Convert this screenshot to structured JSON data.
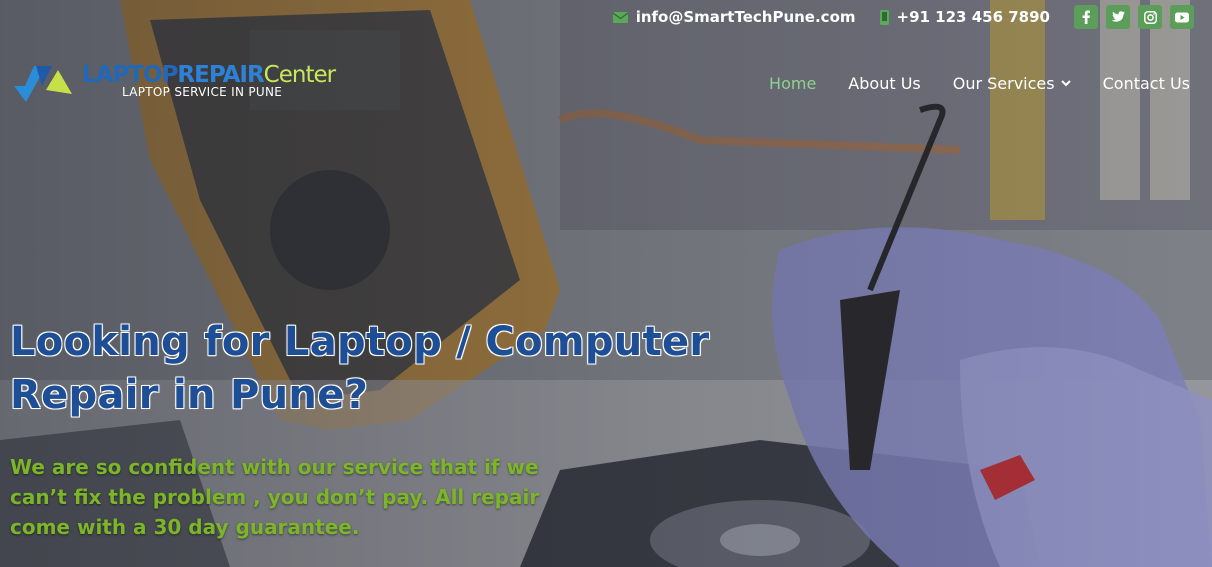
{
  "topbar": {
    "email": "info@SmartTechPune.com",
    "phone": "+91 123 456 7890",
    "socials": [
      "facebook-icon",
      "twitter-icon",
      "instagram-icon",
      "youtube-icon"
    ]
  },
  "logo": {
    "part1": "LAPTOP",
    "part2": "REPAIR",
    "part3": "Center",
    "tagline": "LAPTOP SERVICE IN PUNE"
  },
  "nav": {
    "items": [
      {
        "label": "Home",
        "active": true
      },
      {
        "label": "About Us",
        "active": false
      },
      {
        "label": "Our Services",
        "active": false,
        "dropdown": true
      },
      {
        "label": "Contact Us",
        "active": false
      }
    ]
  },
  "hero": {
    "headline": "Looking for Laptop / Computer Repair in Pune?",
    "subline": "We are so confident with our service that if we can’t fix the problem , you don’t pay. All repair come with a 30 day guarantee."
  },
  "colors": {
    "accent_green": "#5a9e5a",
    "nav_active": "#8fd28f",
    "headline_blue": "#1e4e96",
    "subline_green": "#7db529"
  }
}
